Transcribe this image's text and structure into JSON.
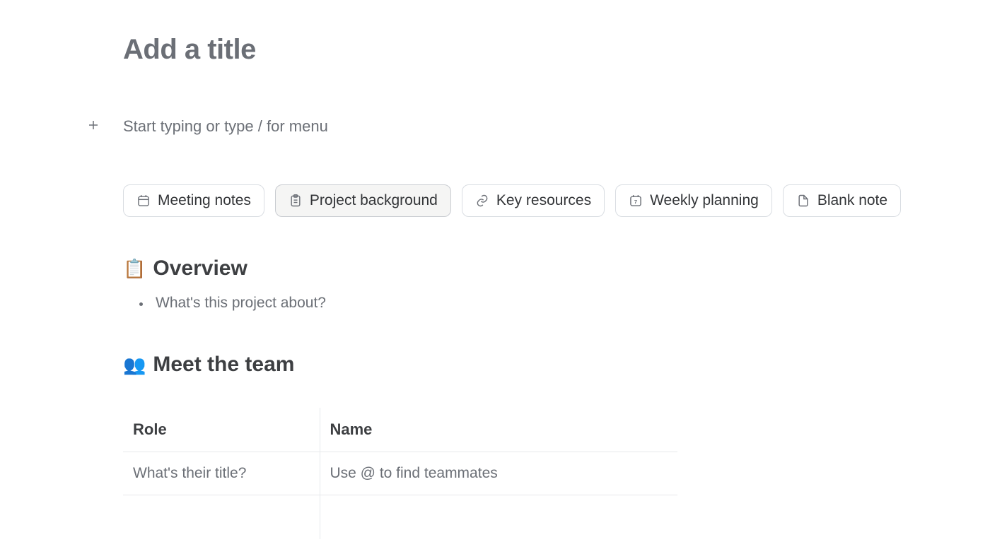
{
  "title": {
    "placeholder": "Add a title"
  },
  "body": {
    "placeholder": "Start typing or type / for menu"
  },
  "templates": [
    {
      "id": "meeting-notes",
      "label": "Meeting notes",
      "icon": "calendar-icon",
      "selected": false
    },
    {
      "id": "project-background",
      "label": "Project background",
      "icon": "clipboard-icon",
      "selected": true
    },
    {
      "id": "key-resources",
      "label": "Key resources",
      "icon": "link-icon",
      "selected": false
    },
    {
      "id": "weekly-planning",
      "label": "Weekly planning",
      "icon": "calendar-7-icon",
      "selected": false
    },
    {
      "id": "blank-note",
      "label": "Blank note",
      "icon": "file-icon",
      "selected": false
    }
  ],
  "sections": {
    "overview": {
      "emoji": "📋",
      "heading": "Overview",
      "bullets": [
        "What's this project about?"
      ]
    },
    "team": {
      "emoji": "👥",
      "heading": "Meet the team",
      "columns": [
        "Role",
        "Name"
      ],
      "rows": [
        {
          "role_placeholder": "What's their title?",
          "name_placeholder": "Use @ to find teammates"
        },
        {
          "role_placeholder": "",
          "name_placeholder": ""
        }
      ]
    }
  }
}
